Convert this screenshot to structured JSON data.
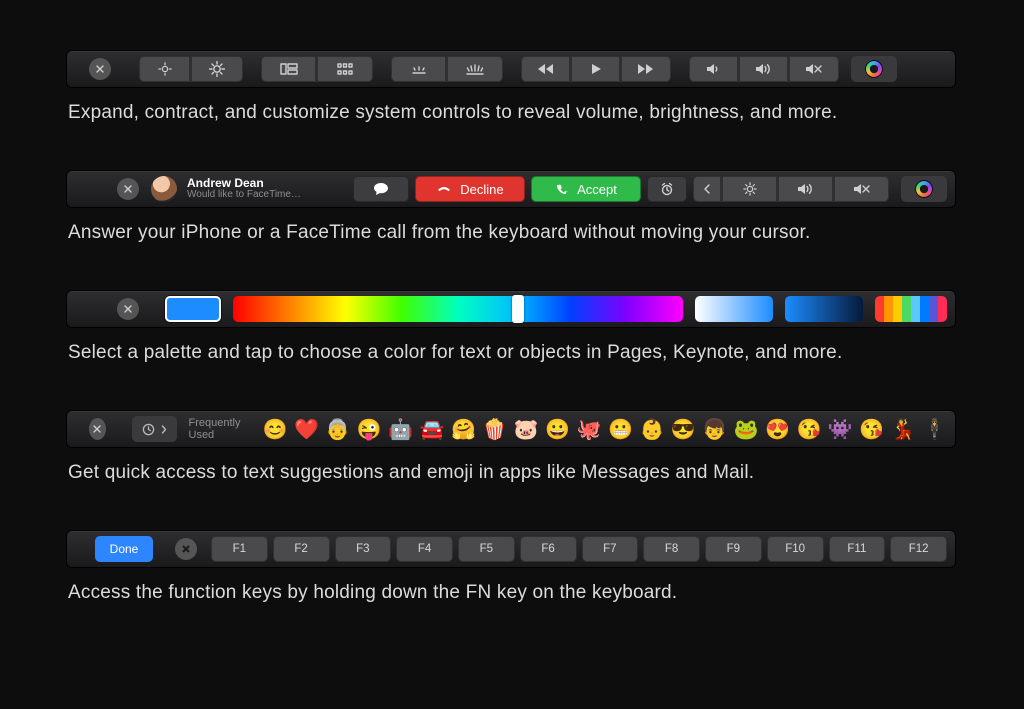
{
  "row1": {
    "caption": "Expand, contract, and customize system controls to reveal volume, brightness, and more."
  },
  "row2": {
    "caller_name": "Andrew Dean",
    "caller_sub": "Would like to FaceTime…",
    "decline": "Decline",
    "accept": "Accept",
    "caption": "Answer your iPhone or a FaceTime call from the keyboard without moving your cursor."
  },
  "row3": {
    "selected_color": "#1d8cff",
    "hue_handle_percent": 62,
    "palette": [
      "#ff3b30",
      "#ff9500",
      "#ffcc00",
      "#4cd964",
      "#5ac8fa",
      "#007aff",
      "#5856d6",
      "#ff2d55"
    ],
    "caption": "Select a palette and tap to choose a color for text or objects in Pages, Keynote, and more."
  },
  "row4": {
    "label": "Frequently Used",
    "emoji": [
      "😊",
      "❤️",
      "👵",
      "😜",
      "🤖",
      "🚘",
      "🤗",
      "🍿",
      "🐷",
      "😀",
      "🐙",
      "😬",
      "👶",
      "😎",
      "👦",
      "🐸",
      "😍",
      "😘",
      "👾",
      "😘",
      "💃",
      "🕴"
    ],
    "caption": "Get quick access to text suggestions and emoji in apps like Messages and Mail."
  },
  "row5": {
    "done": "Done",
    "fkeys": [
      "F1",
      "F2",
      "F3",
      "F4",
      "F5",
      "F6",
      "F7",
      "F8",
      "F9",
      "F10",
      "F11",
      "F12"
    ],
    "caption": "Access the function keys by holding down the FN key on the keyboard."
  }
}
